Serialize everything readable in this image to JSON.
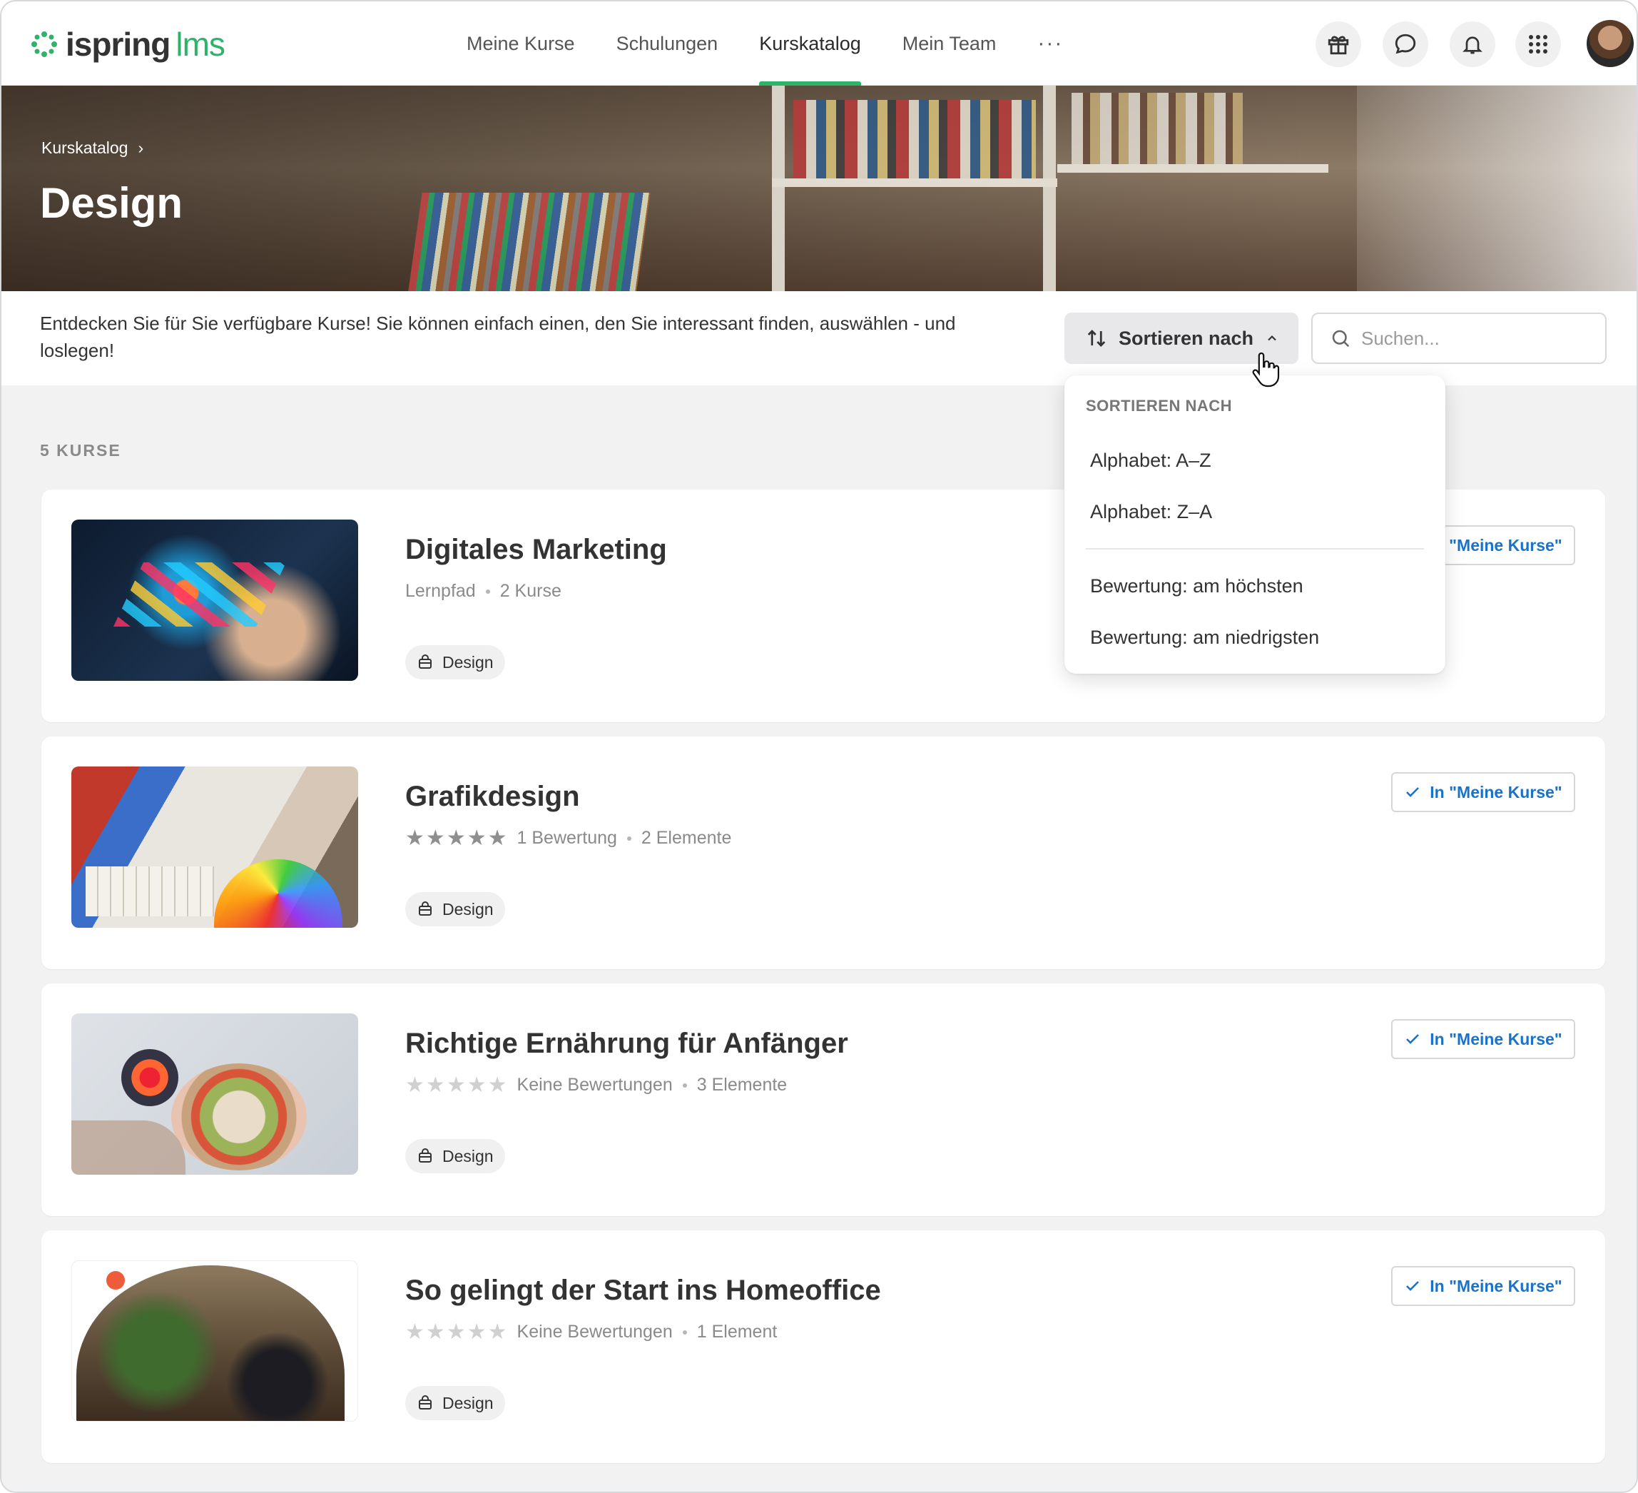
{
  "brand": {
    "name": "ispring",
    "suffix": "lms",
    "color": "#2fb36b"
  },
  "nav": {
    "items": [
      {
        "label": "Meine Kurse",
        "active": false
      },
      {
        "label": "Schulungen",
        "active": false
      },
      {
        "label": "Kurskatalog",
        "active": true
      },
      {
        "label": "Mein Team",
        "active": false
      }
    ],
    "more": "···"
  },
  "header_icons": [
    "gift-icon",
    "chat-icon",
    "bell-icon",
    "apps-grid-icon"
  ],
  "breadcrumb": {
    "label": "Kurskatalog",
    "separator": "›"
  },
  "page_title": "Design",
  "intro_text": "Entdecken Sie für Sie verfügbare Kurse! Sie können einfach einen, den Sie interessant finden, auswählen - und loslegen!",
  "sort": {
    "label": "Sortieren nach",
    "icon": "sort-arrows-icon",
    "open": true
  },
  "search": {
    "placeholder": "Suchen...",
    "value": ""
  },
  "course_count": "5 KURSE",
  "dropdown": {
    "heading": "SORTIEREN NACH",
    "options": [
      "Alphabet: A–Z",
      "Alphabet: Z–A",
      "Bewertung: am höchsten",
      "Bewertung: am niedrigsten"
    ]
  },
  "courses": [
    {
      "title": "Digitales Marketing",
      "meta1": "Lernpfad",
      "meta2": "2 Kurse",
      "rating_stars": 0,
      "show_stars": false,
      "tag": "Design",
      "button": "In \"Meine Kurse\""
    },
    {
      "title": "Grafikdesign",
      "meta1": "1 Bewertung",
      "meta2": "2 Elemente",
      "rating_stars": 5,
      "show_stars": true,
      "tag": "Design",
      "button": "In \"Meine Kurse\""
    },
    {
      "title": "Richtige Ernährung für Anfänger",
      "meta1": "Keine Bewertungen",
      "meta2": "3 Elemente",
      "rating_stars": 0,
      "show_stars": true,
      "tag": "Design",
      "button": "In \"Meine Kurse\""
    },
    {
      "title": "So gelingt der Start ins Homeoffice",
      "meta1": "Keine Bewertungen",
      "meta2": "1 Element",
      "rating_stars": 0,
      "show_stars": true,
      "tag": "Design",
      "button": "In \"Meine Kurse\""
    }
  ],
  "colors": {
    "accent": "#2fb36b",
    "link": "#1a73c8",
    "star_filled": "#8f8f8f",
    "star_empty": "#d0d0d0"
  }
}
